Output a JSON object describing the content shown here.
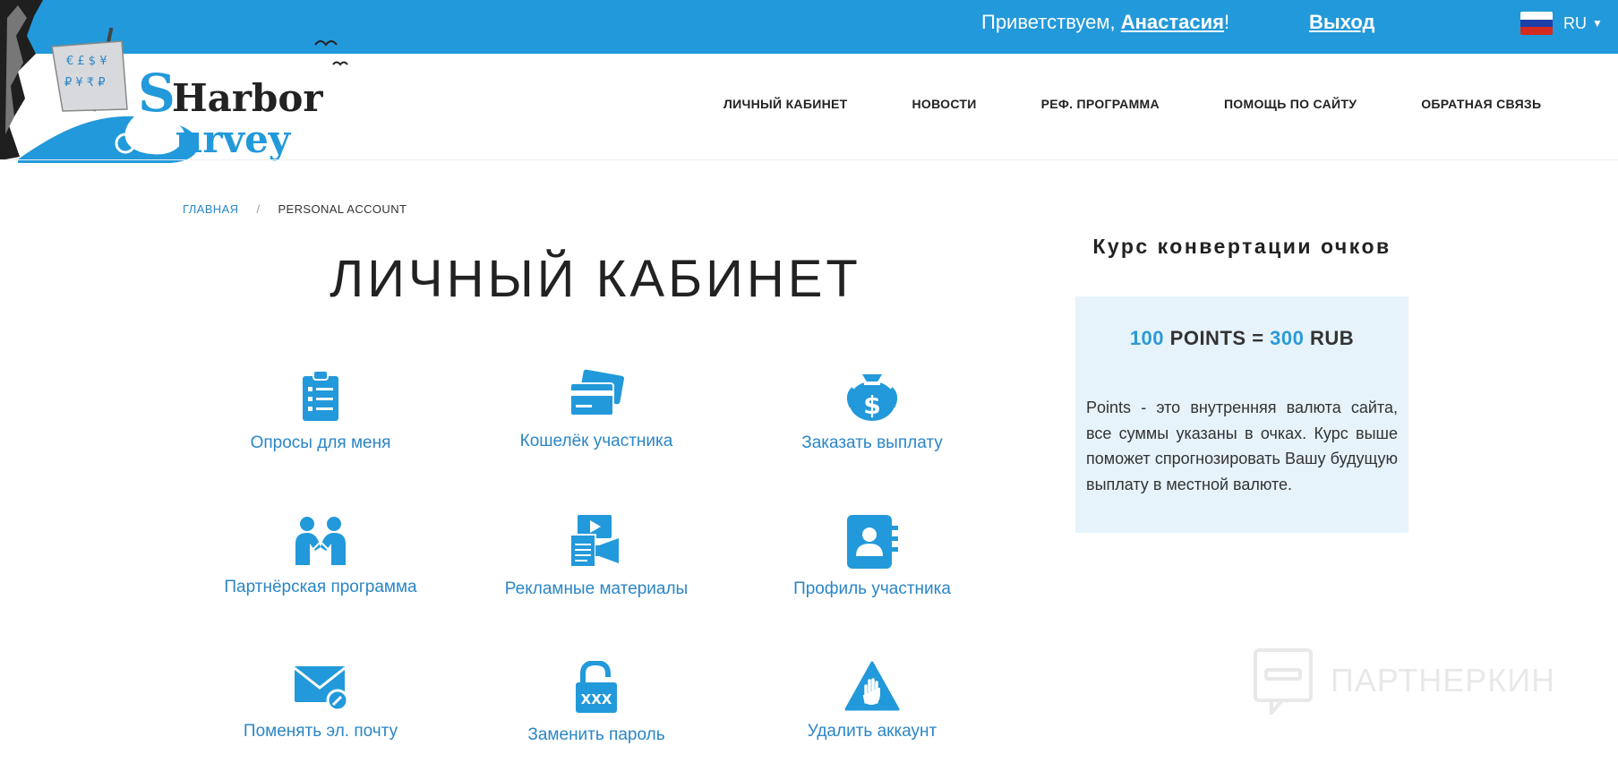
{
  "header": {
    "greeting_prefix": "Приветствуем, ",
    "user_name": "Анастасия",
    "greeting_suffix": "!",
    "logout_label": "Выход",
    "language": "RU"
  },
  "logo": {
    "line1": "Harbor",
    "line2": "Survey"
  },
  "nav": {
    "items": [
      {
        "label": "ЛИЧНЫЙ КАБИНЕТ"
      },
      {
        "label": "НОВОСТИ"
      },
      {
        "label": "РЕФ. ПРОГРАММА"
      },
      {
        "label": "ПОМОЩЬ ПО САЙТУ"
      },
      {
        "label": "ОБРАТНАЯ СВЯЗЬ"
      }
    ]
  },
  "breadcrumb": {
    "home": "ГЛАВНАЯ",
    "separator": "/",
    "current": "PERSONAL ACCOUNT"
  },
  "page_title": "ЛИЧНЫЙ КАБИНЕТ",
  "tiles": [
    {
      "label": "Опросы для меня",
      "icon": "clipboard-list-icon"
    },
    {
      "label": "Кошелёк участника",
      "icon": "credit-cards-icon"
    },
    {
      "label": "Заказать выплату",
      "icon": "money-bag-icon"
    },
    {
      "label": "Партнёрская программа",
      "icon": "handshake-people-icon"
    },
    {
      "label": "Рекламные материалы",
      "icon": "video-megaphone-icon"
    },
    {
      "label": "Профиль участника",
      "icon": "contact-book-icon"
    },
    {
      "label": "Поменять эл. почту",
      "icon": "envelope-edit-icon"
    },
    {
      "label": "Заменить пароль",
      "icon": "unlocked-padlock-icon"
    },
    {
      "label": "Удалить аккаунт",
      "icon": "warning-hand-icon"
    }
  ],
  "sidebar": {
    "title": "Курс конвертации очков",
    "rate": {
      "points": "100",
      "points_unit": "POINTS",
      "equals": "=",
      "rub": "300",
      "rub_unit": "RUB"
    },
    "description": "Points - это внутренняя валюта сайта, все суммы указаны в очках. Курс выше поможет спрогнозировать Вашу будущую выплату в местной валюте."
  },
  "watermark": "ПАРТНЕРКИН",
  "colors": {
    "topbar": "#2299da",
    "accent": "#2b86c6",
    "icon": "#2299da",
    "rate_box": "#e6f3fb"
  }
}
